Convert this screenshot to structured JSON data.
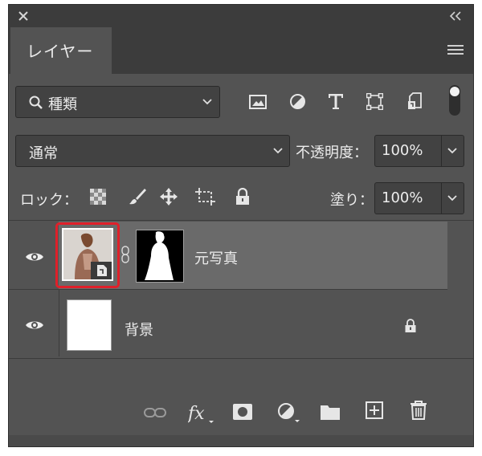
{
  "panel": {
    "tab_title": "レイヤー"
  },
  "filter": {
    "kind_label": "種類"
  },
  "blend": {
    "mode": "通常",
    "opacity_label": "不透明度：",
    "opacity_value": "100%"
  },
  "lock": {
    "label": "ロック：",
    "fill_label": "塗り：",
    "fill_value": "100%"
  },
  "layers": [
    {
      "name": "元写真",
      "selected": true,
      "visible": true
    },
    {
      "name": "背景",
      "selected": false,
      "visible": true,
      "locked": true
    }
  ],
  "colors": {
    "panel_bg": "#535353",
    "header_bg": "#3c3c3c",
    "selected_row": "#6a6a6a",
    "highlight_border": "#e0202a"
  }
}
